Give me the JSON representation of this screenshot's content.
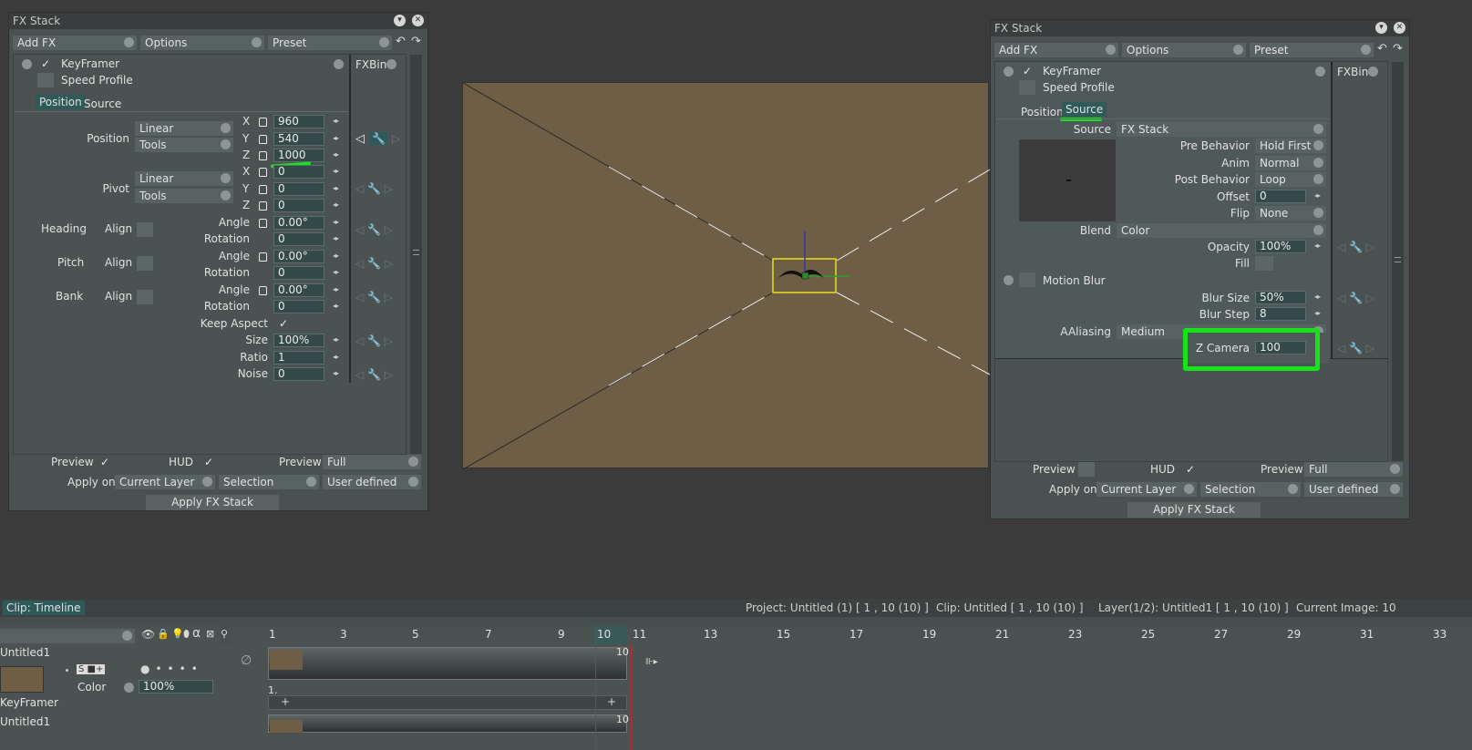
{
  "left_panel": {
    "title": "FX Stack",
    "toolbar": {
      "add_fx": "Add FX",
      "options": "Options",
      "preset": "Preset"
    },
    "fx": {
      "name": "KeyFramer",
      "speed_profile": "Speed Profile",
      "bin": "FXBin"
    },
    "tabs": {
      "position": "Position",
      "source": "Source"
    },
    "position": {
      "label": "Position",
      "interp": "Linear",
      "tools": "Tools",
      "x_label": "X",
      "y_label": "Y",
      "z_label": "Z",
      "x": "960",
      "y": "540",
      "z": "1000"
    },
    "pivot": {
      "label": "Pivot",
      "interp": "Linear",
      "tools": "Tools",
      "x_label": "X",
      "y_label": "Y",
      "z_label": "Z",
      "x": "0",
      "y": "0",
      "z": "0"
    },
    "heading": {
      "label": "Heading",
      "align": "Align",
      "angle_label": "Angle",
      "angle": "0.00°",
      "rotation_label": "Rotation",
      "rotation": "0"
    },
    "pitch": {
      "label": "Pitch",
      "align": "Align",
      "angle_label": "Angle",
      "angle": "0.00°",
      "rotation_label": "Rotation",
      "rotation": "0"
    },
    "bank": {
      "label": "Bank",
      "align": "Align",
      "angle_label": "Angle",
      "angle": "0.00°",
      "rotation_label": "Rotation",
      "rotation": "0"
    },
    "keep_aspect": "Keep Aspect",
    "size_label": "Size",
    "size": "100%",
    "ratio_label": "Ratio",
    "ratio": "1",
    "noise_label": "Noise",
    "noise": "0",
    "bottom": {
      "preview": "Preview",
      "hud": "HUD",
      "preview2": "Preview",
      "preview_val": "Full",
      "apply_on": "Apply on",
      "current_layer": "Current Layer",
      "selection": "Selection",
      "user_defined": "User defined",
      "apply": "Apply FX Stack"
    }
  },
  "right_panel": {
    "title": "FX Stack",
    "toolbar": {
      "add_fx": "Add FX",
      "options": "Options",
      "preset": "Preset"
    },
    "fx": {
      "name": "KeyFramer",
      "speed_profile": "Speed Profile",
      "bin": "FXBin"
    },
    "tabs": {
      "position": "Position",
      "source": "Source"
    },
    "source_label": "Source",
    "source_val": "FX Stack",
    "pre_behavior_label": "Pre Behavior",
    "pre_behavior": "Hold First",
    "anim_label": "Anim",
    "anim": "Normal",
    "post_behavior_label": "Post Behavior",
    "post_behavior": "Loop",
    "offset_label": "Offset",
    "offset": "0",
    "flip_label": "Flip",
    "flip": "None",
    "blend_label": "Blend",
    "blend": "Color",
    "opacity_label": "Opacity",
    "opacity": "100%",
    "fill_label": "Fill",
    "motion_blur": "Motion Blur",
    "blur_size_label": "Blur Size",
    "blur_size": "50%",
    "blur_step_label": "Blur Step",
    "blur_step": "8",
    "aaliasing_label": "AAliasing",
    "aaliasing": "Medium",
    "zcamera_label": "Z Camera",
    "zcamera": "100",
    "bottom": {
      "preview": "Preview",
      "hud": "HUD",
      "preview2": "Preview",
      "preview_val": "Full",
      "apply_on": "Apply on",
      "current_layer": "Current Layer",
      "selection": "Selection",
      "user_defined": "User defined",
      "apply": "Apply FX Stack"
    }
  },
  "timeline": {
    "tab": "Clip: Timeline",
    "project": "Project: Untitled (1) [ 1 , 10  (10) ]",
    "clip": "Clip: Untitled [ 1 , 10  (10) ]",
    "layer": "Layer(1/2): Untitled1 [ 1 , 10  (10) ]",
    "current_image": "Current Image: 10",
    "ticks": [
      "1",
      "3",
      "5",
      "7",
      "9",
      "10",
      "11",
      "13",
      "15",
      "17",
      "19",
      "21",
      "23",
      "25",
      "27",
      "29",
      "31",
      "33"
    ],
    "layer1": "Untitled1",
    "color_label": "Color",
    "opacity": "100%",
    "keyframer": "KeyFramer",
    "layer2": "Untitled1",
    "end_frame": "10",
    "end_frame2": "10",
    "row_marker": "1."
  },
  "colors": {
    "highlight": "#17e31a",
    "canvas": "#6e5e45",
    "panel": "#4a5151"
  }
}
